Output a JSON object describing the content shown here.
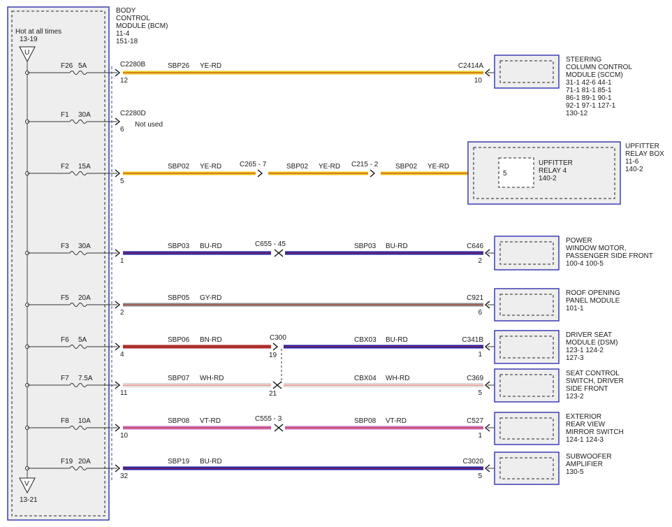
{
  "bcm": {
    "title_lines": [
      "BODY",
      "CONTROL",
      "MODULE (BCM)",
      "11-4",
      "151-18"
    ],
    "hot_label": "Hot at all times",
    "hot_ref": "13-19",
    "ground_ref": "13-21",
    "arrow_glyph_top": "U",
    "arrow_glyph_bottom": "V"
  },
  "circuits": [
    {
      "fuse": "F26",
      "amps": "5A",
      "bcm_connector": "C2280B",
      "bcm_pin": "12",
      "color": "#f2c81a",
      "stripe": "#c0392b",
      "segments": [
        {
          "circuit": "SBP26",
          "wire": "YE-RD"
        }
      ],
      "splices": [],
      "end_connector": "C2414A",
      "end_pin": "10",
      "module": {
        "lines": [
          "STEERING",
          "COLUMN CONTROL",
          "MODULE (SCCM)"
        ],
        "refs": [
          "31-1    42-6    44-1",
          "71-1    81-1    85-1",
          "86-1    89-1    90-1",
          "92-1    97-1    127-1",
          "130-12"
        ]
      }
    },
    {
      "fuse": "F1",
      "amps": "30A",
      "bcm_connector": "C2280D",
      "bcm_pin": "6",
      "note": "Not used"
    },
    {
      "fuse": "F2",
      "amps": "15A",
      "bcm_pin": "5",
      "color": "#f2c81a",
      "stripe": "#c0392b",
      "segments": [
        {
          "circuit": "SBP02",
          "wire": "YE-RD"
        },
        {
          "circuit": "SBP02",
          "wire": "YE-RD"
        },
        {
          "circuit": "SBP02",
          "wire": "YE-RD"
        }
      ],
      "splices": [
        "C265 - 7",
        "C215 - 2"
      ],
      "module": {
        "lines": [
          "UPFITTER",
          "RELAY BOX"
        ],
        "refs": [
          "11-6",
          "140-2"
        ]
      },
      "relay": {
        "pin": "5",
        "lines": [
          "UPFITTER",
          "RELAY 4"
        ],
        "ref": "140-2"
      }
    },
    {
      "fuse": "F3",
      "amps": "30A",
      "bcm_pin": "1",
      "color": "#1d1aa8",
      "stripe": "#c0392b",
      "segments": [
        {
          "circuit": "SBP03",
          "wire": "BU-RD"
        },
        {
          "circuit": "SBP03",
          "wire": "BU-RD"
        }
      ],
      "splices": [
        "C655 - 45"
      ],
      "end_connector": "C646",
      "end_pin": "2",
      "module": {
        "lines": [
          "POWER",
          "WINDOW MOTOR,",
          "PASSENGER SIDE FRONT"
        ],
        "refs": [
          "100-4    100-5"
        ]
      }
    },
    {
      "fuse": "F5",
      "amps": "20A",
      "bcm_pin": "2",
      "color": "#8a8a8a",
      "stripe": "#c0392b",
      "segments": [
        {
          "circuit": "SBP05",
          "wire": "GY-RD"
        }
      ],
      "splices": [],
      "end_connector": "C921",
      "end_pin": "6",
      "module": {
        "lines": [
          "ROOF OPENING",
          "PANEL MODULE"
        ],
        "refs": [
          "101-1"
        ]
      }
    },
    {
      "fuse": "F6",
      "amps": "5A",
      "bcm_pin": "4",
      "segments": [
        {
          "circuit": "SBP06",
          "wire": "BN-RD",
          "color": "#a52a2a",
          "stripe": "#c0392b"
        },
        {
          "circuit": "CBX03",
          "wire": "BU-RD",
          "color": "#1d1aa8",
          "stripe": "#c0392b"
        }
      ],
      "junction": {
        "label": "C300",
        "pin_in": "19",
        "pin_out": "21"
      },
      "end_connector": "C341B",
      "end_pin": "1",
      "module": {
        "lines": [
          "DRIVER SEAT",
          "MODULE (DSM)"
        ],
        "refs": [
          "123-1    124-2",
          "127-3"
        ]
      }
    },
    {
      "fuse": "F7",
      "amps": "7.5A",
      "bcm_pin": "11",
      "segments": [
        {
          "circuit": "SBP07",
          "wire": "WH-RD",
          "color": "#ffffff",
          "stripe": "#c0392b"
        },
        {
          "circuit": "CBX04",
          "wire": "WH-RD",
          "color": "#ffffff",
          "stripe": "#c0392b"
        }
      ],
      "end_connector": "C369",
      "end_pin": "5",
      "module": {
        "lines": [
          "SEAT CONTROL",
          "SWITCH, DRIVER",
          "SIDE FRONT"
        ],
        "refs": [
          "123-2"
        ]
      }
    },
    {
      "fuse": "F8",
      "amps": "10A",
      "bcm_pin": "10",
      "color": "#d070c0",
      "stripe": "#c0392b",
      "segments": [
        {
          "circuit": "SBP08",
          "wire": "VT-RD"
        },
        {
          "circuit": "SBP08",
          "wire": "VT-RD"
        }
      ],
      "splices": [
        "C555 - 3"
      ],
      "end_connector": "C527",
      "end_pin": "1",
      "module": {
        "lines": [
          "EXTERIOR",
          "REAR VIEW",
          "MIRROR SWITCH"
        ],
        "refs": [
          "124-1    124-3"
        ]
      }
    },
    {
      "fuse": "F19",
      "amps": "20A",
      "bcm_pin": "32",
      "color": "#1d1aa8",
      "stripe": "#c0392b",
      "segments": [
        {
          "circuit": "SBP19",
          "wire": "BU-RD"
        }
      ],
      "splices": [],
      "end_connector": "C3020",
      "end_pin": "5",
      "module": {
        "lines": [
          "SUBWOOFER",
          "AMPLIFIER"
        ],
        "refs": [
          "130-5"
        ]
      }
    }
  ],
  "colors": {
    "module_border": "#3b3bb3",
    "module_fill": "#eeeeee",
    "bcm_border": "#3b3bb3"
  }
}
